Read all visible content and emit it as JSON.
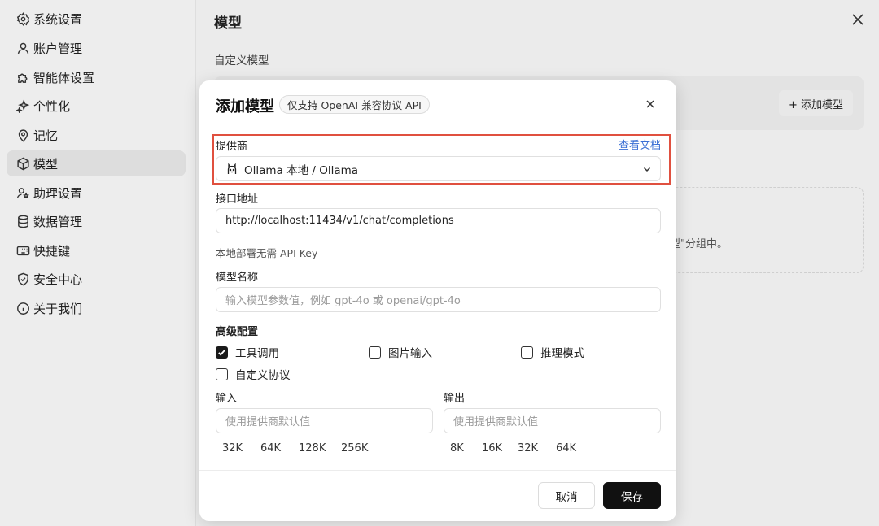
{
  "sidebar": {
    "items": [
      {
        "label": "系统设置",
        "icon": "gear-icon"
      },
      {
        "label": "账户管理",
        "icon": "user-icon"
      },
      {
        "label": "智能体设置",
        "icon": "puzzle-icon"
      },
      {
        "label": "个性化",
        "icon": "sparkle-icon"
      },
      {
        "label": "记忆",
        "icon": "memory-icon"
      },
      {
        "label": "模型",
        "icon": "cube-icon",
        "active": true
      },
      {
        "label": "助理设置",
        "icon": "assistant-icon"
      },
      {
        "label": "数据管理",
        "icon": "database-icon"
      },
      {
        "label": "快捷键",
        "icon": "keyboard-icon"
      },
      {
        "label": "安全中心",
        "icon": "shield-icon"
      },
      {
        "label": "关于我们",
        "icon": "info-icon"
      }
    ]
  },
  "page": {
    "title": "模型",
    "section_label": "自定义模型",
    "add_model_label": "+ 添加模型",
    "dashed_text": "型\"分组中。"
  },
  "dialog": {
    "title": "添加模型",
    "badge": "仅支持 OpenAI 兼容协议 API",
    "provider": {
      "label": "提供商",
      "doc_link": "查看文档",
      "value": "Ollama 本地 / Ollama"
    },
    "endpoint": {
      "label": "接口地址",
      "value": "http://localhost:11434/v1/chat/completions",
      "hint": "本地部署无需 API Key"
    },
    "model_name": {
      "label": "模型名称",
      "placeholder": "输入模型参数值，例如 gpt-4o 或 openai/gpt-4o"
    },
    "advanced": {
      "label": "高级配置",
      "options": [
        {
          "label": "工具调用",
          "checked": true
        },
        {
          "label": "图片输入",
          "checked": false
        },
        {
          "label": "推理模式",
          "checked": false
        },
        {
          "label": "自定义协议",
          "checked": false
        }
      ]
    },
    "input": {
      "label": "输入",
      "placeholder": "使用提供商默认值",
      "presets": [
        "32K",
        "64K",
        "128K",
        "256K"
      ]
    },
    "output": {
      "label": "输出",
      "placeholder": "使用提供商默认值",
      "presets": [
        "8K",
        "16K",
        "32K",
        "64K"
      ]
    },
    "cancel_label": "取消",
    "save_label": "保存"
  },
  "colors": {
    "highlight_border": "#e0503f",
    "link": "#3b6fd4",
    "primary_button": "#111111"
  }
}
